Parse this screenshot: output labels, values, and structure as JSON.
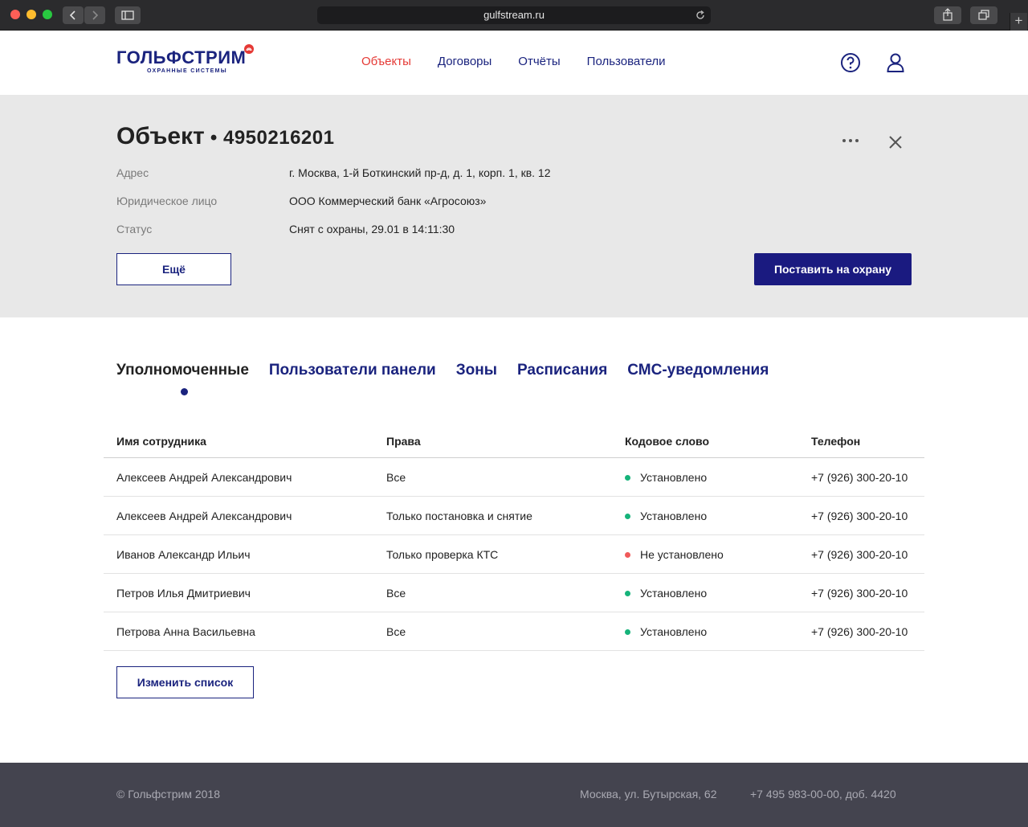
{
  "browser": {
    "url": "gulfstream.ru"
  },
  "header": {
    "logo_main": "ГОЛЬФСТРИМ",
    "logo_sub": "ОХРАННЫЕ СИСТЕМЫ",
    "nav": [
      "Объекты",
      "Договоры",
      "Отчёты",
      "Пользователи"
    ],
    "active_nav": "Объекты"
  },
  "object": {
    "title": "Объект",
    "separator": " • ",
    "number": "4950216201",
    "props": [
      {
        "label": "Адрес",
        "value": "г. Москва, 1-й Боткинский пр-д, д. 1, корп. 1, кв. 12"
      },
      {
        "label": "Юридическое лицо",
        "value": "ООО Коммерческий банк «Агросоюз»"
      },
      {
        "label": "Статус",
        "value": "Снят с охраны, 29.01 в 14:11:30"
      }
    ],
    "more_button": "Ещё",
    "arm_button": "Поставить на охрану"
  },
  "tabs": [
    {
      "label": "Уполномоченные",
      "active": true
    },
    {
      "label": "Пользователи панели",
      "active": false
    },
    {
      "label": "Зоны",
      "active": false
    },
    {
      "label": "Расписания",
      "active": false
    },
    {
      "label": "СМС-уведомления",
      "active": false
    }
  ],
  "table": {
    "headers": [
      "Имя сотрудника",
      "Права",
      "Кодовое слово",
      "Телефон"
    ],
    "rows": [
      {
        "name": "Алексеев Андрей Александрович",
        "rights": "Все",
        "codeword": "Установлено",
        "codeword_ok": true,
        "phone": "+7 (926) 300-20-10"
      },
      {
        "name": "Алексеев Андрей Александрович",
        "rights": "Только постановка и снятие",
        "codeword": "Установлено",
        "codeword_ok": true,
        "phone": "+7 (926) 300-20-10"
      },
      {
        "name": "Иванов Александр Ильич",
        "rights": "Только проверка КТС",
        "codeword": "Не установлено",
        "codeword_ok": false,
        "phone": "+7 (926) 300-20-10"
      },
      {
        "name": "Петров Илья Дмитриевич",
        "rights": "Все",
        "codeword": "Установлено",
        "codeword_ok": true,
        "phone": "+7 (926) 300-20-10"
      },
      {
        "name": "Петрова Анна Васильевна",
        "rights": "Все",
        "codeword": "Установлено",
        "codeword_ok": true,
        "phone": "+7 (926) 300-20-10"
      }
    ],
    "edit_button": "Изменить список"
  },
  "colors": {
    "brand": "#1a237e",
    "nav_active": "#e53935",
    "status_ok": "#16b37a",
    "status_bad": "#f05a5a"
  },
  "footer": {
    "copyright": "© Гольфстрим 2018",
    "address": "Москва, ул. Бутырская, 62",
    "phone": "+7 495 983-00-00, доб. 4420"
  }
}
